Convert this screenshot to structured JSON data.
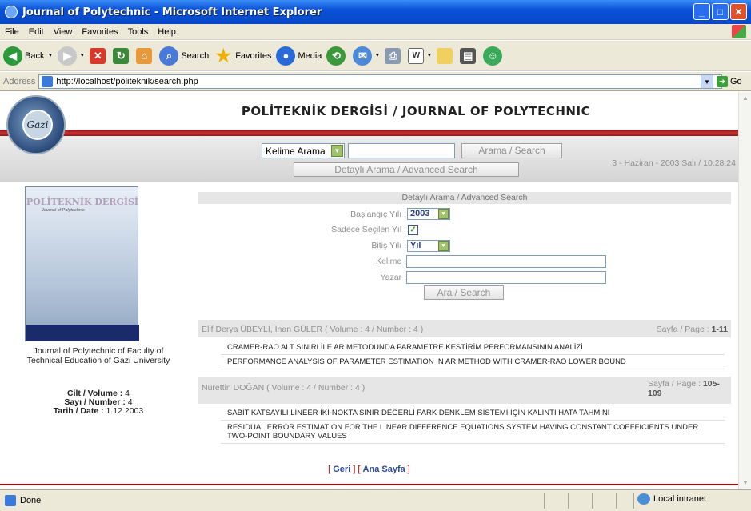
{
  "window": {
    "title": "Journal of Polytechnic - Microsoft Internet Explorer"
  },
  "menu": [
    "File",
    "Edit",
    "View",
    "Favorites",
    "Tools",
    "Help"
  ],
  "toolbar": {
    "back": "Back",
    "search": "Search",
    "favorites": "Favorites",
    "media": "Media"
  },
  "address": {
    "label": "Address",
    "url": "http://localhost/politeknik/search.php",
    "go": "Go"
  },
  "header": {
    "title": "POLİTEKNİK DERGİSİ / JOURNAL OF POLYTECHNIC",
    "logo_text": "Gazi",
    "search_type": "Kelime Arama",
    "search_button": "Arama / Search",
    "advanced_button": "Detaylı Arama / Advanced Search",
    "date": "3 - Haziran - 2003 Salı / 10.28:24"
  },
  "left": {
    "cover_title": "POLİTEKNİK DERGİSİ",
    "cover_subtitle": "Journal of Polytechnic",
    "caption": "Journal of Polytechnic of Faculty of Technical Education of Gazi University",
    "volume_label": "Cilt / Volume :",
    "volume": "4",
    "number_label": "Sayı / Number :",
    "number": "4",
    "date_label": "Tarih / Date :",
    "date": "1.12.2003"
  },
  "form": {
    "heading": "Detaylı Arama / Advanced Search",
    "start_year_label": "Başlangıç Yılı :",
    "start_year": "2003",
    "only_selected_label": "Sadece Seçilen Yıl :",
    "end_year_label": "Bitiş Yılı :",
    "end_year": "Yıl",
    "keyword_label": "Kelime :",
    "author_label": "Yazar :",
    "search_button": "Ara / Search"
  },
  "results": [
    {
      "authors": "Elif Derya ÜBEYLİ, İnan GÜLER ( Volume : 4 / Number : 4 )",
      "page_label": "Sayfa / Page :",
      "pages": "1-11",
      "title_tr": "CRAMER-RAO ALT SINIRI İLE AR METODUNDA PARAMETRE KESTİRİM PERFORMANSININ ANALİZİ",
      "title_en": "PERFORMANCE ANALYSIS OF PARAMETER ESTIMATION IN AR METHOD WITH CRAMER-RAO LOWER BOUND"
    },
    {
      "authors": "Nurettin DOĞAN ( Volume : 4 / Number : 4 )",
      "page_label": "Sayfa / Page :",
      "pages": "105-109",
      "title_tr": "SABİT KATSAYILI LİNEER İKİ-NOKTA SINIR DEĞERLİ FARK DENKLEM SİSTEMİ İÇİN KALINTI HATA TAHMİNİ",
      "title_en": "RESIDUAL ERROR ESTIMATION FOR THE LINEAR DIFFERENCE EQUATIONS SYSTEM HAVING CONSTANT COEFFICIENTS UNDER TWO-POINT BOUNDARY VALUES"
    }
  ],
  "nav": {
    "back": "Geri",
    "home": "Ana Sayfa"
  },
  "status": {
    "text": "Done",
    "zone": "Local intranet"
  }
}
